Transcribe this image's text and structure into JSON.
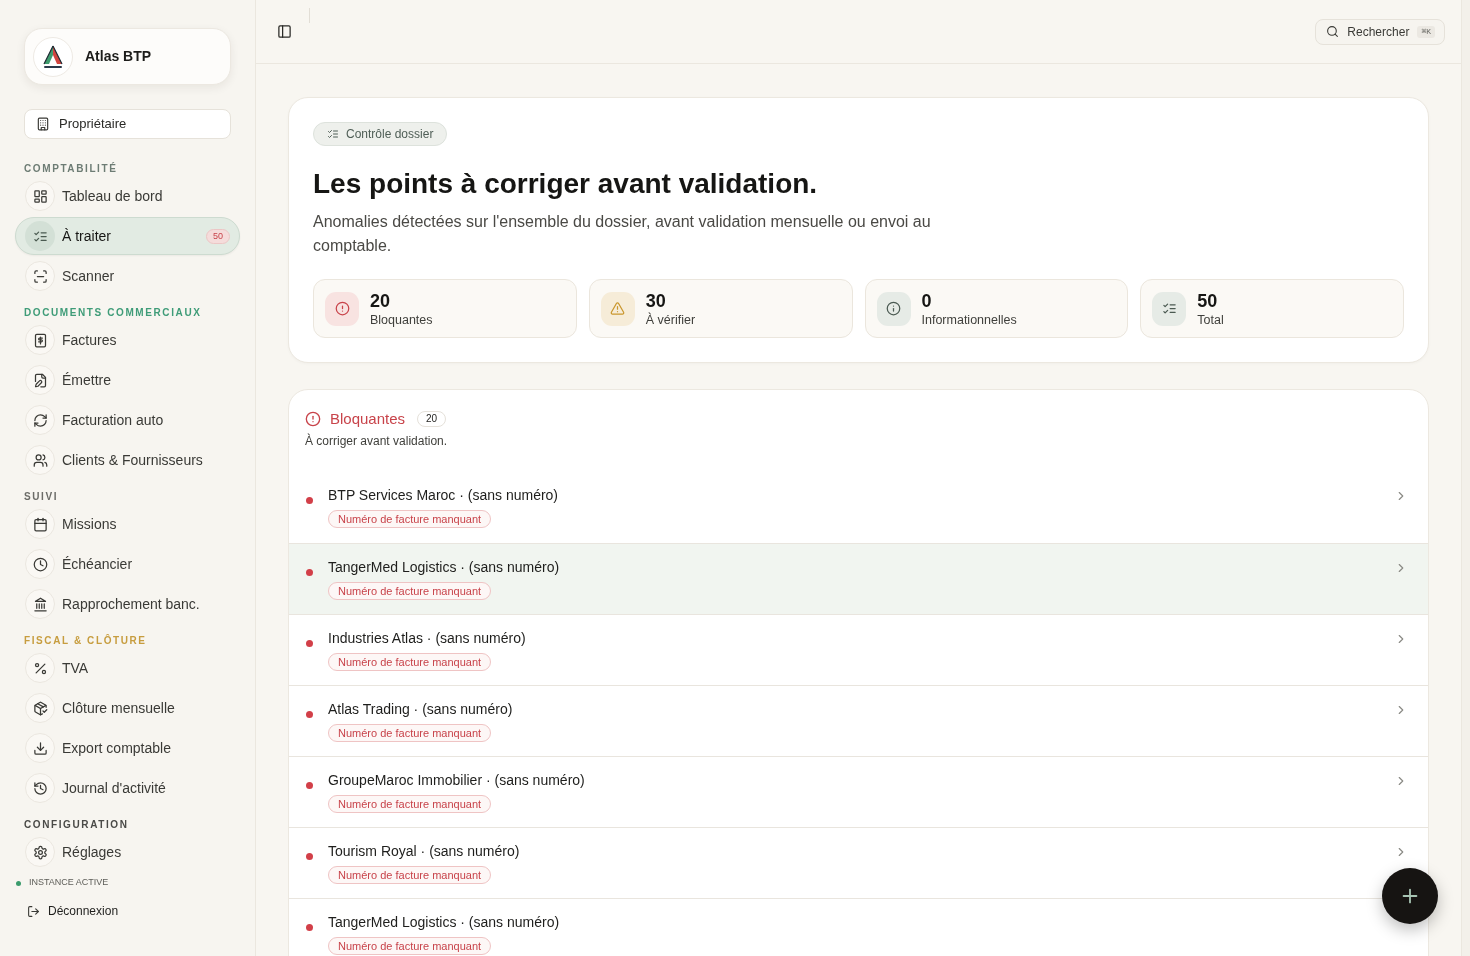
{
  "sidebar": {
    "workspace": {
      "name": "Atlas BTP"
    },
    "role": {
      "label": "Propriétaire"
    },
    "sections": [
      {
        "title": "COMPTABILITÉ",
        "color": "#6d7c74",
        "items": [
          {
            "label": "Tableau de bord",
            "selected": false
          },
          {
            "label": "À traiter",
            "selected": true,
            "badge": "50"
          },
          {
            "label": "Scanner",
            "selected": false
          }
        ]
      },
      {
        "title": "DOCUMENTS COMMERCIAUX",
        "color": "#3f9c78",
        "items": [
          {
            "label": "Factures",
            "selected": false
          },
          {
            "label": "Émettre",
            "selected": false
          },
          {
            "label": "Facturation auto",
            "selected": false
          },
          {
            "label": "Clients & Fournisseurs",
            "selected": false
          }
        ]
      },
      {
        "title": "SUIVI",
        "color": "#6b6b67",
        "items": [
          {
            "label": "Missions",
            "selected": false
          },
          {
            "label": "Échéancier",
            "selected": false
          },
          {
            "label": "Rapprochement banc.",
            "selected": false
          }
        ]
      },
      {
        "title": "FISCAL & CLÔTURE",
        "color": "#c79d3f",
        "items": [
          {
            "label": "TVA",
            "selected": false
          },
          {
            "label": "Clôture mensuelle",
            "selected": false
          },
          {
            "label": "Export comptable",
            "selected": false
          },
          {
            "label": "Journal d'activité",
            "selected": false
          }
        ]
      },
      {
        "title": "CONFIGURATION",
        "color": "#4a4a47",
        "items": [
          {
            "label": "Réglages",
            "selected": false
          }
        ]
      }
    ],
    "status": {
      "label": "INSTANCE ACTIVE",
      "active": true
    },
    "logout": {
      "label": "Déconnexion"
    }
  },
  "topbar": {
    "search": {
      "label": "Rechercher",
      "shortcut": "⌘K"
    }
  },
  "summary": {
    "tag": "Contrôle dossier",
    "title": "Les points à corriger avant validation.",
    "description": "Anomalies détectées sur l'ensemble du dossier, avant validation mensuelle ou envoi au comptable.",
    "stats": [
      {
        "kind": "blocking",
        "value": "20",
        "label": "Bloquantes"
      },
      {
        "kind": "warning",
        "value": "30",
        "label": "À vérifier"
      },
      {
        "kind": "info",
        "value": "0",
        "label": "Informationnelles"
      },
      {
        "kind": "total",
        "value": "50",
        "label": "Total"
      }
    ]
  },
  "issues": {
    "kind": "blocking",
    "title": "Bloquantes",
    "count": "20",
    "subtitle": "À corriger avant validation.",
    "rows": [
      {
        "title": "BTP Services Maroc · (sans numéro)",
        "tag": "Numéro de facture manquant",
        "selected": false
      },
      {
        "title": "TangerMed Logistics · (sans numéro)",
        "tag": "Numéro de facture manquant",
        "selected": true
      },
      {
        "title": "Industries Atlas · (sans numéro)",
        "tag": "Numéro de facture manquant",
        "selected": false
      },
      {
        "title": "Atlas Trading · (sans numéro)",
        "tag": "Numéro de facture manquant",
        "selected": false
      },
      {
        "title": "GroupeMaroc Immobilier · (sans numéro)",
        "tag": "Numéro de facture manquant",
        "selected": false
      },
      {
        "title": "Tourism Royal · (sans numéro)",
        "tag": "Numéro de facture manquant",
        "selected": false
      },
      {
        "title": "TangerMed Logistics · (sans numéro)",
        "tag": "Numéro de facture manquant",
        "selected": false
      }
    ]
  }
}
